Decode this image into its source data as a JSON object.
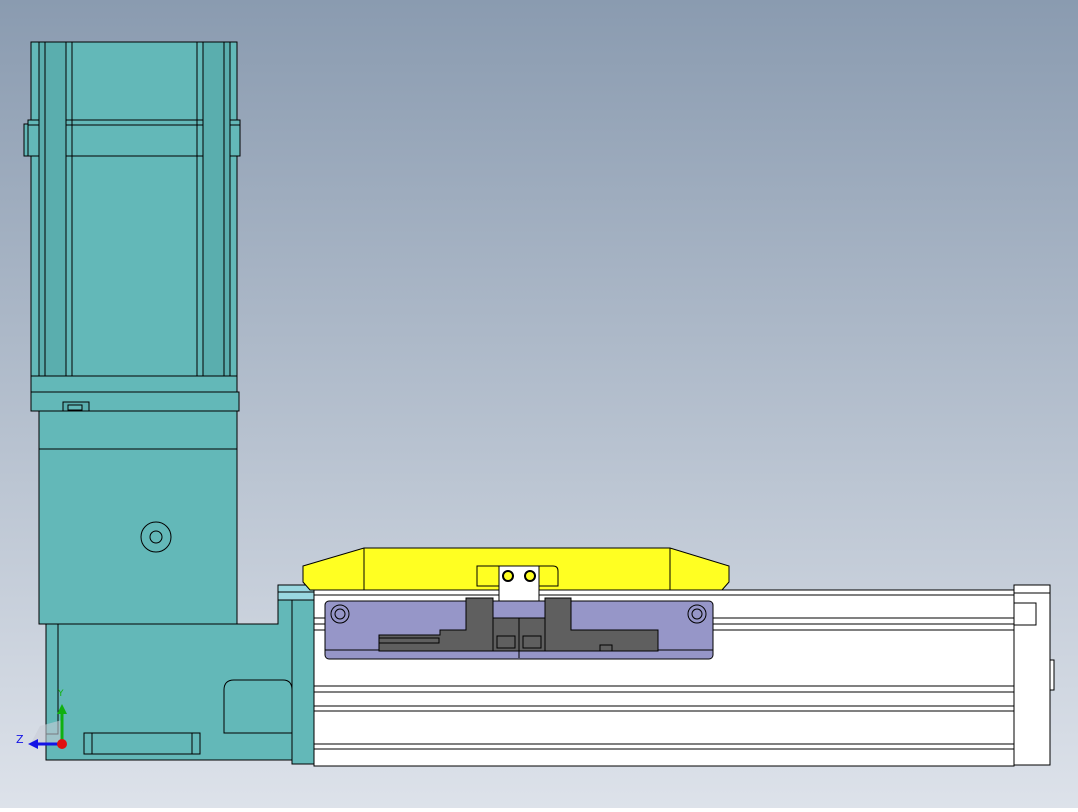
{
  "view": {
    "background_top": "#8a9bb0",
    "background_bottom": "#d9dee7"
  },
  "colors": {
    "motor": "#63b8b8",
    "yellow_plate": "#ffff22",
    "carriage": "#9696c8",
    "dark_gray": "#5f5f5f",
    "rail_white": "#ffffff",
    "edge": "#000000",
    "x_axis": "#1414e6",
    "y_axis": "#10b010",
    "z_axis": "#e01010"
  },
  "triad": {
    "z_label": "Z",
    "y_label": "Y"
  }
}
